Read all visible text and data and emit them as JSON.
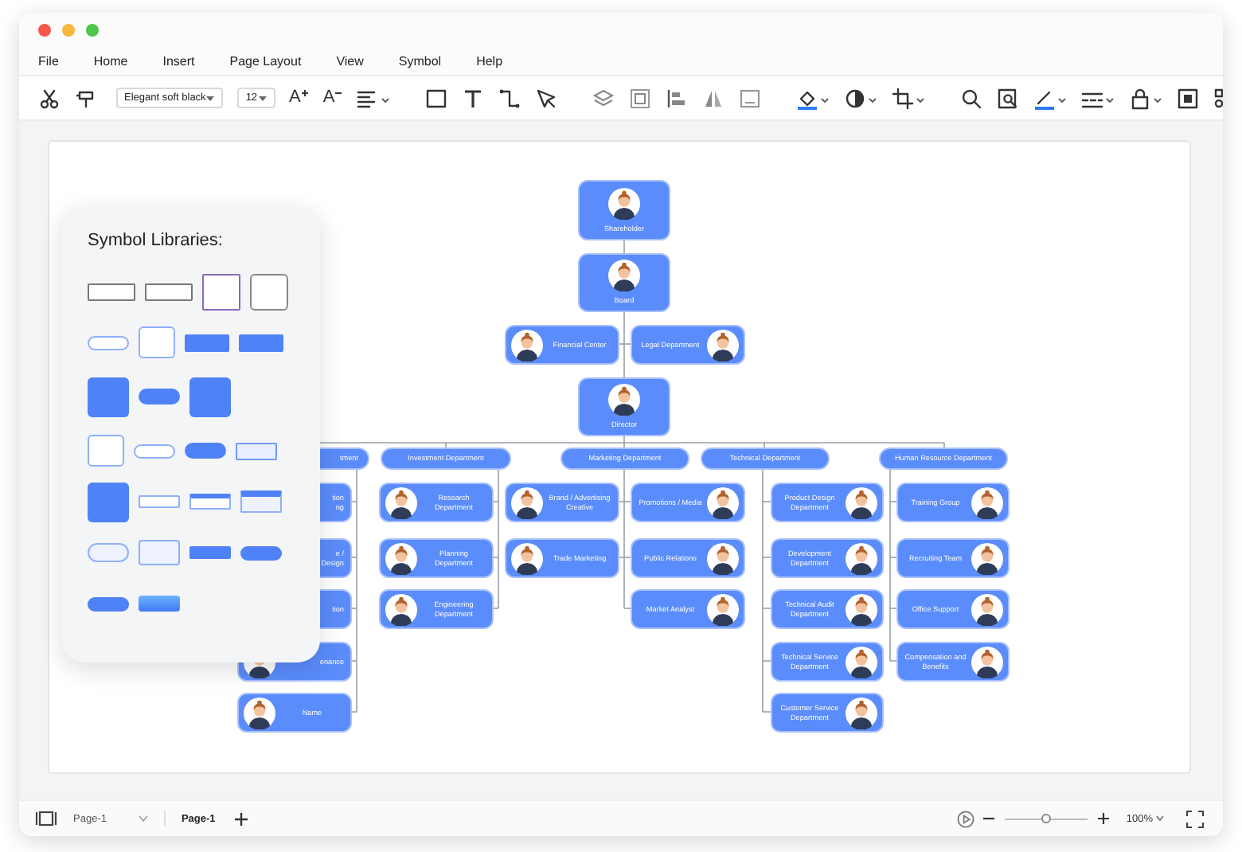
{
  "menu": [
    "File",
    "Home",
    "Insert",
    "Page Layout",
    "View",
    "Symbol",
    "Help"
  ],
  "toolbar": {
    "font": "Elegant soft black",
    "font_size": "12",
    "grow_label": "A",
    "shrink_label": "A"
  },
  "org_chart": {
    "root": {
      "kind": "card",
      "label": "Shareholder",
      "children": [
        {
          "kind": "card",
          "label": "Board",
          "children": [
            {
              "kind": "avatar-left",
              "label": "Financial Center"
            },
            {
              "kind": "avatar-right",
              "label": "Legal Department"
            },
            {
              "kind": "card",
              "label": "Director",
              "children": [
                {
                  "kind": "pill-cut",
                  "label": "tment",
                  "children": [
                    {
                      "kind": "covered-left",
                      "label": "tion\nng"
                    },
                    {
                      "kind": "covered-left",
                      "label": "e /\nDesign"
                    },
                    {
                      "kind": "covered-left",
                      "label": "tion"
                    },
                    {
                      "kind": "avatar-left-cut",
                      "label": "enance"
                    },
                    {
                      "kind": "avatar-left",
                      "label": "Name"
                    }
                  ]
                },
                {
                  "kind": "pill",
                  "label": "Investment Department",
                  "children": [
                    {
                      "kind": "avatar-left",
                      "label": "Research Department"
                    },
                    {
                      "kind": "avatar-left",
                      "label": "Planning Department"
                    },
                    {
                      "kind": "avatar-left",
                      "label": "Engineering Department"
                    }
                  ]
                },
                {
                  "kind": "pill",
                  "label": "Marketing Department",
                  "children": [
                    {
                      "kind": "avatar-left",
                      "label": "Brand / Advertising Creative"
                    },
                    {
                      "kind": "avatar-left",
                      "label": "Trade Marketing"
                    },
                    {
                      "kind": "avatar-right",
                      "label": "Promotions / Media"
                    },
                    {
                      "kind": "avatar-right",
                      "label": "Public Relations"
                    },
                    {
                      "kind": "avatar-right",
                      "label": "Market Analyst"
                    }
                  ]
                },
                {
                  "kind": "pill",
                  "label": "Technical Department",
                  "children": [
                    {
                      "kind": "avatar-right",
                      "label": "Product Design Department"
                    },
                    {
                      "kind": "avatar-right",
                      "label": "Development Department"
                    },
                    {
                      "kind": "avatar-right",
                      "label": "Technical Audit Department"
                    },
                    {
                      "kind": "avatar-right",
                      "label": "Technical Service Department"
                    },
                    {
                      "kind": "avatar-right",
                      "label": "Customer Service Department"
                    }
                  ]
                },
                {
                  "kind": "pill",
                  "label": "Human Resource Department",
                  "children": [
                    {
                      "kind": "avatar-right",
                      "label": "Training Group"
                    },
                    {
                      "kind": "avatar-right",
                      "label": "Recruiting Team"
                    },
                    {
                      "kind": "avatar-right",
                      "label": "Office Support"
                    },
                    {
                      "kind": "avatar-right",
                      "label": "Compensation and Benefits"
                    }
                  ]
                }
              ]
            }
          ]
        }
      ]
    }
  },
  "symbol_libraries": {
    "title": "Symbol Libraries:",
    "rows": [
      [
        {
          "kind": "outline-wide"
        },
        {
          "kind": "outline-wide"
        },
        {
          "kind": "portrait-purple"
        },
        {
          "kind": "portrait-gray"
        }
      ],
      [
        {
          "kind": "pill-outline"
        },
        {
          "kind": "portrait-blue"
        },
        {
          "kind": "blue-wide"
        },
        {
          "kind": "blue-wide"
        }
      ],
      [
        {
          "kind": "blue-square"
        },
        {
          "kind": "blue-pill-avatar"
        },
        {
          "kind": "blue-square"
        }
      ],
      [
        {
          "kind": "portrait-blue"
        },
        {
          "kind": "pill-outline"
        },
        {
          "kind": "blue-pill-avatar"
        },
        {
          "kind": "outline-blue-wide"
        }
      ],
      [
        {
          "kind": "blue-square"
        },
        {
          "kind": "outline-rect"
        },
        {
          "kind": "outline-header"
        },
        {
          "kind": "outline-box-header"
        }
      ],
      [
        {
          "kind": "outline-pill"
        },
        {
          "kind": "outline-box"
        },
        {
          "kind": "blue-rect"
        },
        {
          "kind": "blue-pill"
        }
      ],
      [
        {
          "kind": "blue-pill"
        },
        {
          "kind": "gradient-rect"
        }
      ]
    ]
  },
  "status_bar": {
    "page_dropdown": "Page-1",
    "pages": [
      {
        "label": "Page-1",
        "selected": true
      }
    ],
    "zoom": {
      "level": 0.5,
      "reading": "100%"
    }
  }
}
